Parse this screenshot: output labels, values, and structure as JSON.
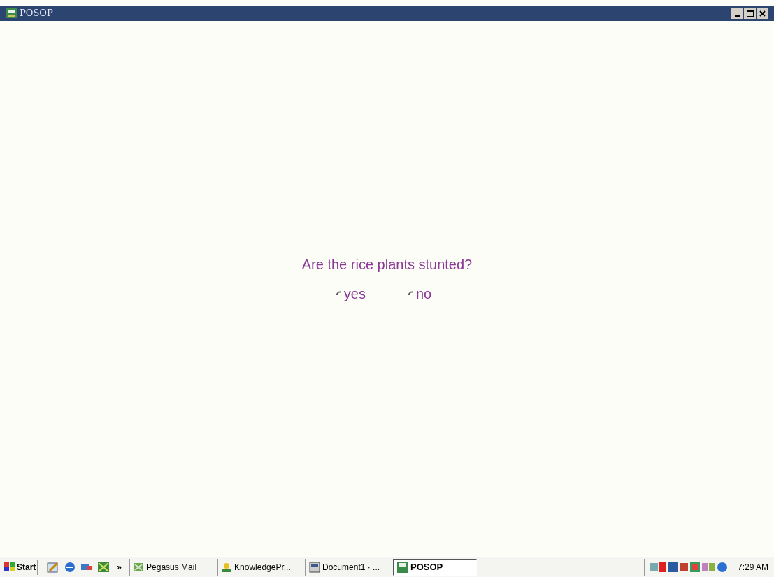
{
  "window": {
    "title": "POSOP"
  },
  "question": {
    "text": "Are the rice plants stunted?",
    "options": [
      {
        "label": "yes",
        "selected": false
      },
      {
        "label": "no",
        "selected": false
      }
    ]
  },
  "taskbar": {
    "start": "Start",
    "more": "»",
    "tasks": [
      {
        "label": "Pegasus Mail",
        "selected": false
      },
      {
        "label": "KnowledgePr...",
        "selected": false
      },
      {
        "label": "Document1 · ...",
        "selected": false
      },
      {
        "label": "POSOP",
        "selected": true
      }
    ],
    "clock": "7:29 AM"
  }
}
